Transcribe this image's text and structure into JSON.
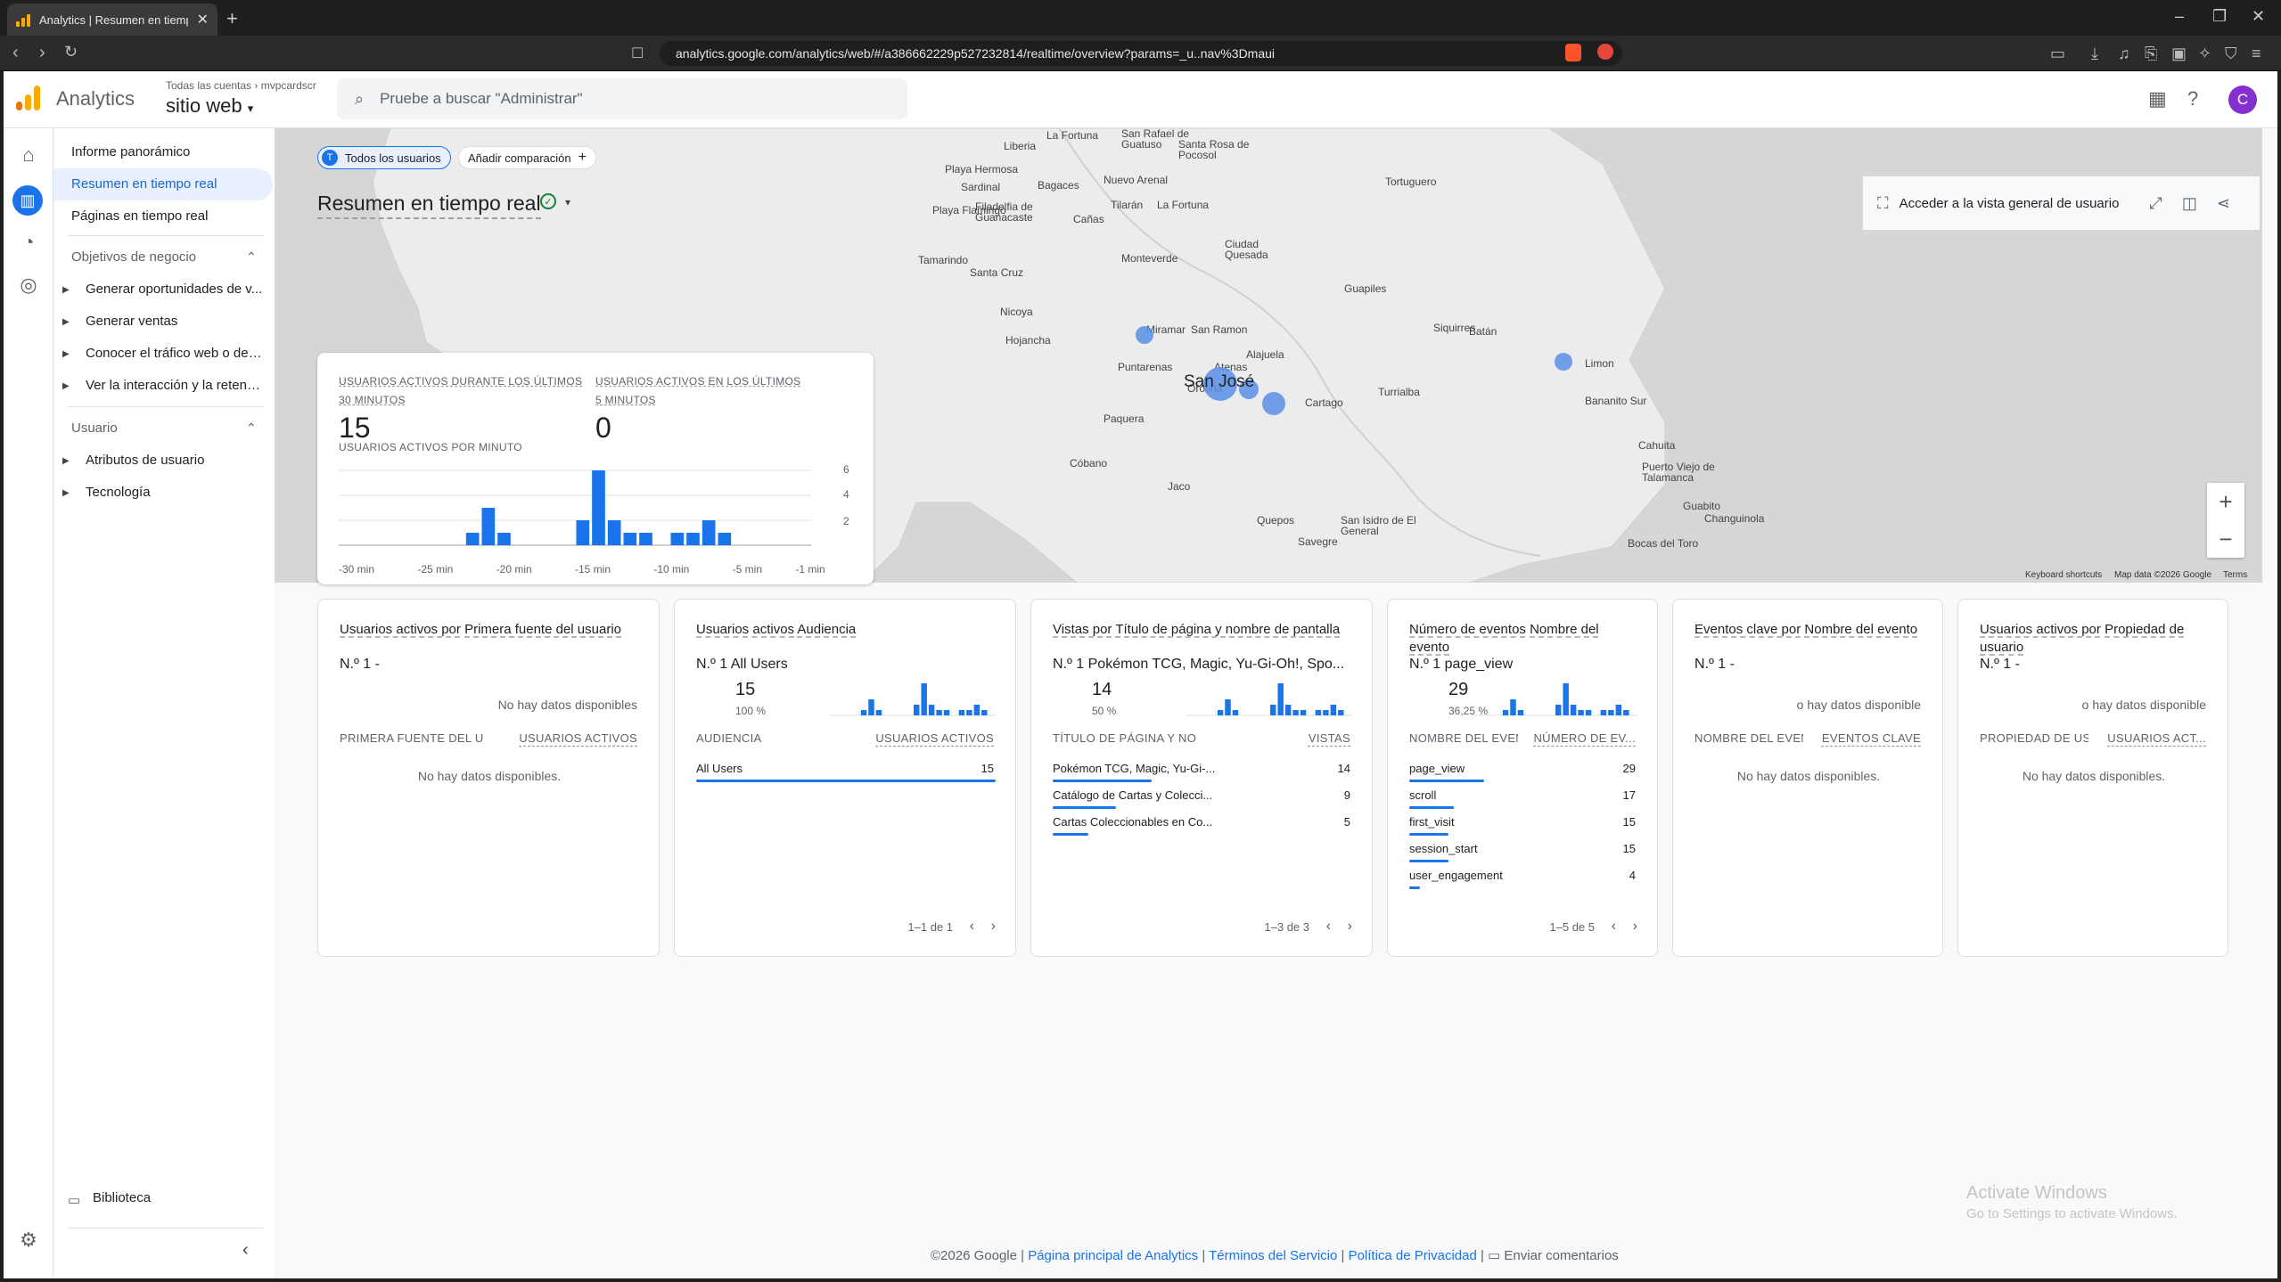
{
  "browser": {
    "tab_title": "Analytics | Resumen en tiempo real",
    "url": "analytics.google.com/analytics/web/#/a386662229p527232814/realtime/overview?params=_u..nav%3Dmaui"
  },
  "header": {
    "app_name": "Analytics",
    "account_path": "Todas las cuentas",
    "account_name": "mvpcardscr",
    "property": "sitio web",
    "search_placeholder": "Pruebe a buscar \"Administrar\"",
    "avatar_letter": "C"
  },
  "sidenav": {
    "overview": "Informe panorámico",
    "realtime": "Resumen en tiempo real",
    "pages": "Páginas en tiempo real",
    "section1": "Objetivos de negocio",
    "section1_items": [
      "Generar oportunidades de v...",
      "Generar ventas",
      "Conocer el tráfico web o de a...",
      "Ver la interacción y la retenci..."
    ],
    "section2": "Usuario",
    "section2_items": [
      "Atributos de usuario",
      "Tecnología"
    ],
    "library": "Biblioteca"
  },
  "toolbar": {
    "chip_all": "Todos los usuarios",
    "chip_all_letter": "T",
    "chip_add": "Añadir comparación",
    "title": "Resumen en tiempo real",
    "user_view": "Acceder a la vista general de usuario"
  },
  "map": {
    "cities": [
      {
        "n": "La Fortuna",
        "x": 266,
        "y": 2
      },
      {
        "n": "San Rafael de Guatuso",
        "x": 350,
        "y": 0
      },
      {
        "n": "Santa Rosa de Pocosol",
        "x": 414,
        "y": 12
      },
      {
        "n": "Liberia",
        "x": 218,
        "y": 14
      },
      {
        "n": "Playa Hermosa",
        "x": 152,
        "y": 40
      },
      {
        "n": "Sardinal",
        "x": 170,
        "y": 60
      },
      {
        "n": "Bagaces",
        "x": 256,
        "y": 58
      },
      {
        "n": "Nuevo Arenal",
        "x": 330,
        "y": 52
      },
      {
        "n": "Tortuguero",
        "x": 646,
        "y": 54
      },
      {
        "n": "Playa Flamingo",
        "x": 138,
        "y": 86
      },
      {
        "n": "Filadelfia de Guanacaste",
        "x": 186,
        "y": 82
      },
      {
        "n": "Cañas",
        "x": 296,
        "y": 96
      },
      {
        "n": "Tilarán",
        "x": 338,
        "y": 80
      },
      {
        "n": "La Fortuna",
        "x": 390,
        "y": 80
      },
      {
        "n": "Ciudad Quesada",
        "x": 466,
        "y": 124
      },
      {
        "n": "Tamarindo",
        "x": 122,
        "y": 142
      },
      {
        "n": "Santa Cruz",
        "x": 180,
        "y": 156
      },
      {
        "n": "Monteverde",
        "x": 350,
        "y": 140
      },
      {
        "n": "Guapiles",
        "x": 600,
        "y": 174
      },
      {
        "n": "Nicoya",
        "x": 214,
        "y": 200
      },
      {
        "n": "Miramar",
        "x": 378,
        "y": 220
      },
      {
        "n": "San Ramon",
        "x": 428,
        "y": 220
      },
      {
        "n": "Siquirres",
        "x": 700,
        "y": 218
      },
      {
        "n": "Batán",
        "x": 740,
        "y": 222
      },
      {
        "n": "Hojancha",
        "x": 220,
        "y": 232
      },
      {
        "n": "Alajuela",
        "x": 490,
        "y": 248
      },
      {
        "n": "Puntarenas",
        "x": 346,
        "y": 262
      },
      {
        "n": "Atenas",
        "x": 454,
        "y": 262
      },
      {
        "n": "Limon",
        "x": 870,
        "y": 258
      },
      {
        "n": "Orotina",
        "x": 424,
        "y": 286
      },
      {
        "n": "Turrialba",
        "x": 638,
        "y": 290
      },
      {
        "n": "Cartago",
        "x": 556,
        "y": 302
      },
      {
        "n": "Bananito Sur",
        "x": 870,
        "y": 300
      },
      {
        "n": "Paquera",
        "x": 330,
        "y": 320
      },
      {
        "n": "Cahuita",
        "x": 930,
        "y": 350
      },
      {
        "n": "Cóbano",
        "x": 292,
        "y": 370
      },
      {
        "n": "Puerto Viejo de Talamanca",
        "x": 934,
        "y": 374
      },
      {
        "n": "Jaco",
        "x": 402,
        "y": 396
      },
      {
        "n": "Guabito",
        "x": 980,
        "y": 418
      },
      {
        "n": "Changuinola",
        "x": 1004,
        "y": 432
      },
      {
        "n": "Quepos",
        "x": 502,
        "y": 434
      },
      {
        "n": "San Isidro de El General",
        "x": 596,
        "y": 434
      },
      {
        "n": "Savegre",
        "x": 548,
        "y": 458
      },
      {
        "n": "Bocas del Toro",
        "x": 918,
        "y": 460
      }
    ],
    "main_city": "San José",
    "keyboard": "Keyboard shortcuts",
    "mapdata": "Map data ©2026 Google",
    "terms": "Terms"
  },
  "realtime_card": {
    "label30": "USUARIOS ACTIVOS DURANTE LOS ÚLTIMOS 30 MINUTOS",
    "value30": "15",
    "label5": "USUARIOS ACTIVOS EN LOS ÚLTIMOS 5 MINUTOS",
    "value5": "0",
    "perminute": "USUARIOS ACTIVOS POR MINUTO",
    "yticks": [
      "6",
      "4",
      "2"
    ],
    "xticks": [
      "-30 min",
      "-25 min",
      "-20 min",
      "-15 min",
      "-10 min",
      "-5 min",
      "-1 min"
    ]
  },
  "chart_data": {
    "type": "bar",
    "title": "USUARIOS ACTIVOS POR MINUTO",
    "x": [
      -30,
      -29,
      -28,
      -27,
      -26,
      -25,
      -24,
      -23,
      -22,
      -21,
      -20,
      -19,
      -18,
      -17,
      -16,
      -15,
      -14,
      -13,
      -12,
      -11,
      -10,
      -9,
      -8,
      -7,
      -6,
      -5,
      -4,
      -3,
      -2,
      -1
    ],
    "values": [
      0,
      0,
      0,
      0,
      0,
      0,
      0,
      0,
      1,
      3,
      1,
      0,
      0,
      0,
      0,
      2,
      6,
      2,
      1,
      1,
      0,
      1,
      1,
      2,
      1,
      0,
      0,
      0,
      0,
      0
    ],
    "ylim": [
      0,
      6
    ],
    "grid": true
  },
  "cards": [
    {
      "t1": "Usuarios activos por",
      "t2": "Primera fuente del usuario",
      "rank": "N.º 1  -",
      "nodata_top": "No hay datos disponibles",
      "h1": "PRIMERA FUENTE DEL US...",
      "h2": "USUARIOS ACTIVOS",
      "nodata": "No hay datos disponibles."
    },
    {
      "t1": "Usuarios activos",
      "t2": "Audiencia",
      "rank": "N.º 1  All Users",
      "val": "15",
      "pct": "100 %",
      "h1": "AUDIENCIA",
      "h2": "USUARIOS ACTIVOS",
      "rows": [
        {
          "n": "All Users",
          "v": "15",
          "f": 1
        }
      ],
      "pager": "1–1 de 1"
    },
    {
      "t1": "Vistas por",
      "t2": "Título de página y nombre de pantalla",
      "rank": "N.º 1  Pokémon TCG, Magic, Yu-Gi-Oh!, Spo...",
      "val": "14",
      "pct": "50 %",
      "h1": "TÍTULO DE PÁGINA Y NOM...",
      "h2": "VISTAS",
      "rows": [
        {
          "n": "Pokémon TCG, Magic, Yu-Gi-...",
          "v": "14",
          "f": 1
        },
        {
          "n": "Catálogo de Cartas y Colecci...",
          "v": "9",
          "f": 0.64
        },
        {
          "n": "Cartas Coleccionables en Co...",
          "v": "5",
          "f": 0.36
        }
      ],
      "pager": "1–3 de 3"
    },
    {
      "t1": "Número de eventos",
      "t2": "Nombre del evento",
      "rank": "N.º 1  page_view",
      "val": "29",
      "pct": "36,25 %",
      "h1": "NOMBRE DEL EVEN...",
      "h2": "NÚMERO DE EV...",
      "rows": [
        {
          "n": "page_view",
          "v": "29",
          "f": 1
        },
        {
          "n": "scroll",
          "v": "17",
          "f": 0.59
        },
        {
          "n": "first_visit",
          "v": "15",
          "f": 0.52
        },
        {
          "n": "session_start",
          "v": "15",
          "f": 0.52
        },
        {
          "n": "user_engagement",
          "v": "4",
          "f": 0.14
        }
      ],
      "pager": "1–5 de 5"
    },
    {
      "t1": "Eventos clave por",
      "t2": "Nombre del evento",
      "rank": "N.º 1  -",
      "nodata_top": "o hay datos disponible",
      "h1": "NOMBRE DEL EVEN...",
      "h2": "EVENTOS CLAVE",
      "nodata": "No hay datos disponibles."
    },
    {
      "t1": "Usuarios activos por",
      "t2": "Propiedad de usuario",
      "rank": "N.º 1  -",
      "nodata_top": "o hay datos disponible",
      "h1": "PROPIEDAD DE USU...",
      "h2": "USUARIOS ACT...",
      "nodata": "No hay datos disponibles."
    }
  ],
  "footer": {
    "copy": "©2026 Google",
    "l1": "Página principal de Analytics",
    "l2": "Términos del Servicio",
    "l3": "Política de Privacidad",
    "feedback": "Enviar comentarios"
  },
  "windows": {
    "line1": "Activate Windows",
    "line2": "Go to Settings to activate Windows."
  },
  "colors": {
    "accent": "#1a73e8",
    "map_bg": "#d6d6d6",
    "land": "#ececec",
    "dot": "#5b8fe8"
  }
}
